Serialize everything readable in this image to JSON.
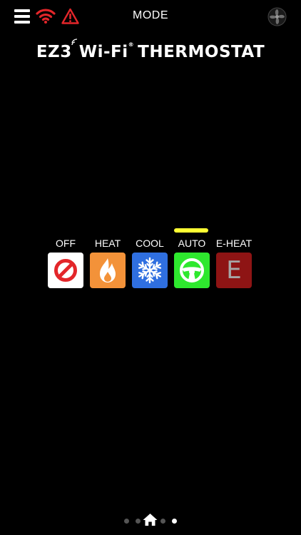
{
  "header": {
    "title": "MODE",
    "icons": {
      "menu": "menu-icon",
      "wifi": "wifi-icon",
      "alert": "alert-icon",
      "fan": "fan-icon"
    }
  },
  "brand": {
    "prefix": "EZ3",
    "wifi": "Wi-Fi",
    "registered": "®",
    "product": "THERMOSTAT"
  },
  "modes": [
    {
      "key": "off",
      "label": "OFF",
      "icon": "prohibited-icon",
      "color": "#ffffff",
      "active": false
    },
    {
      "key": "heat",
      "label": "HEAT",
      "icon": "flame-icon",
      "color": "#f39239",
      "active": false
    },
    {
      "key": "cool",
      "label": "COOL",
      "icon": "snowflake-icon",
      "color": "#2f6fe0",
      "active": false
    },
    {
      "key": "auto",
      "label": "AUTO",
      "icon": "steering-wheel-icon",
      "color": "#2ee82e",
      "active": true
    },
    {
      "key": "eheat",
      "label": "E-HEAT",
      "icon": "e-letter-icon",
      "letter": "E",
      "color": "#8e1414",
      "active": false
    }
  ],
  "colors": {
    "background": "#000000",
    "alert": "#e3262a",
    "wifi": "#e3262a",
    "active_indicator": "#ffff33"
  },
  "pager": {
    "pages": 5,
    "current_index": 4,
    "home_index": 2
  }
}
